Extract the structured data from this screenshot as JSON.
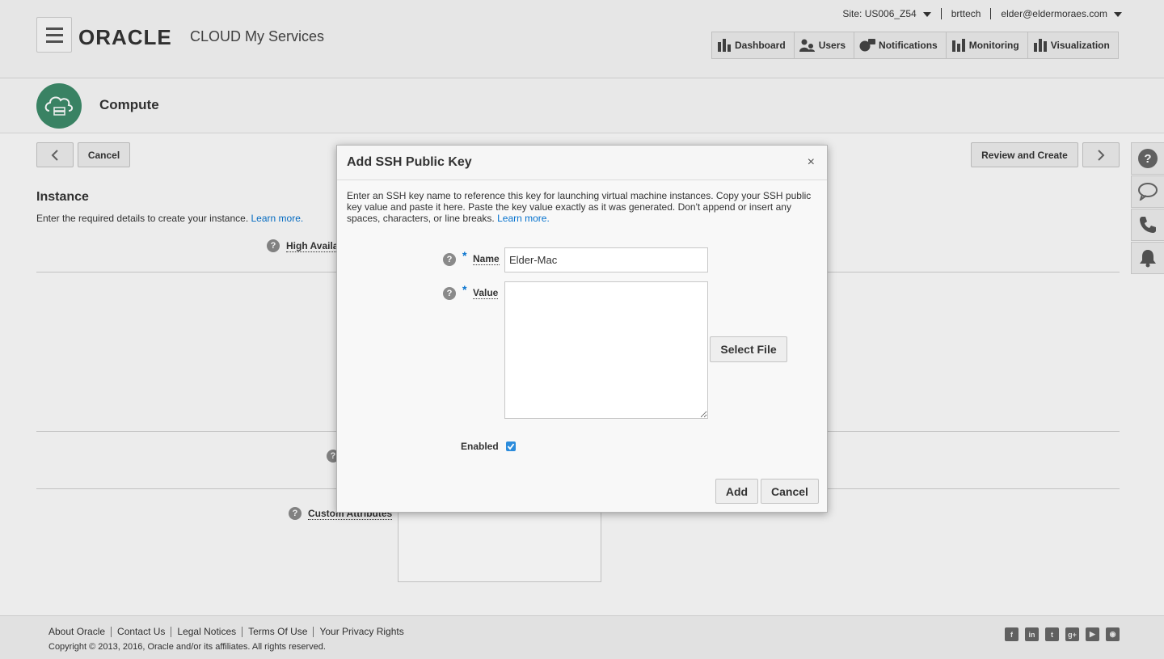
{
  "header": {
    "logo": "ORACLE",
    "product": "CLOUD My Services",
    "site": "Site: US006_Z54",
    "account": "brttech",
    "user": "elder@eldermoraes.com",
    "nav": [
      {
        "label": "Dashboard",
        "icon": "bar-chart-icon"
      },
      {
        "label": "Users",
        "icon": "users-icon"
      },
      {
        "label": "Notifications",
        "icon": "notifications-icon"
      },
      {
        "label": "Monitoring",
        "icon": "monitoring-icon"
      },
      {
        "label": "Visualization",
        "icon": "visualization-icon"
      }
    ]
  },
  "compute": {
    "title": "Compute"
  },
  "wizard": {
    "cancel_label": "Cancel",
    "review_label": "Review and Create"
  },
  "instance": {
    "title": "Instance",
    "desc": "Enter the required details to create your instance.",
    "learn_more": "Learn more.",
    "high_availability_label": "High Availa",
    "custom_attributes_label": "Custom Attributes"
  },
  "dialog": {
    "title": "Add SSH Public Key",
    "close": "×",
    "desc": "Enter an SSH key name to reference this key for launching virtual machine instances. Copy your SSH public key value and paste it here. Paste the key value exactly as it was generated. Don't append or insert any spaces, characters, or line breaks.",
    "learn_more": "Learn more.",
    "name_label": "Name",
    "name_value": "Elder-Mac",
    "value_label": "Value",
    "value_text": "",
    "select_file": "Select File",
    "enabled_label": "Enabled",
    "enabled": true,
    "add_label": "Add",
    "cancel_label": "Cancel"
  },
  "footer": {
    "links": [
      "About Oracle",
      "Contact Us",
      "Legal Notices",
      "Terms Of Use",
      "Your Privacy Rights"
    ],
    "copyright": "Copyright © 2013, 2016, Oracle and/or its affiliates. All rights reserved.",
    "social": [
      "facebook-icon",
      "linkedin-icon",
      "twitter-icon",
      "google-plus-icon",
      "youtube-icon",
      "rss-icon"
    ]
  },
  "colors": {
    "accent": "#0572ce",
    "compute": "#3d8b6a",
    "checkbox": "#2c8cdc"
  }
}
